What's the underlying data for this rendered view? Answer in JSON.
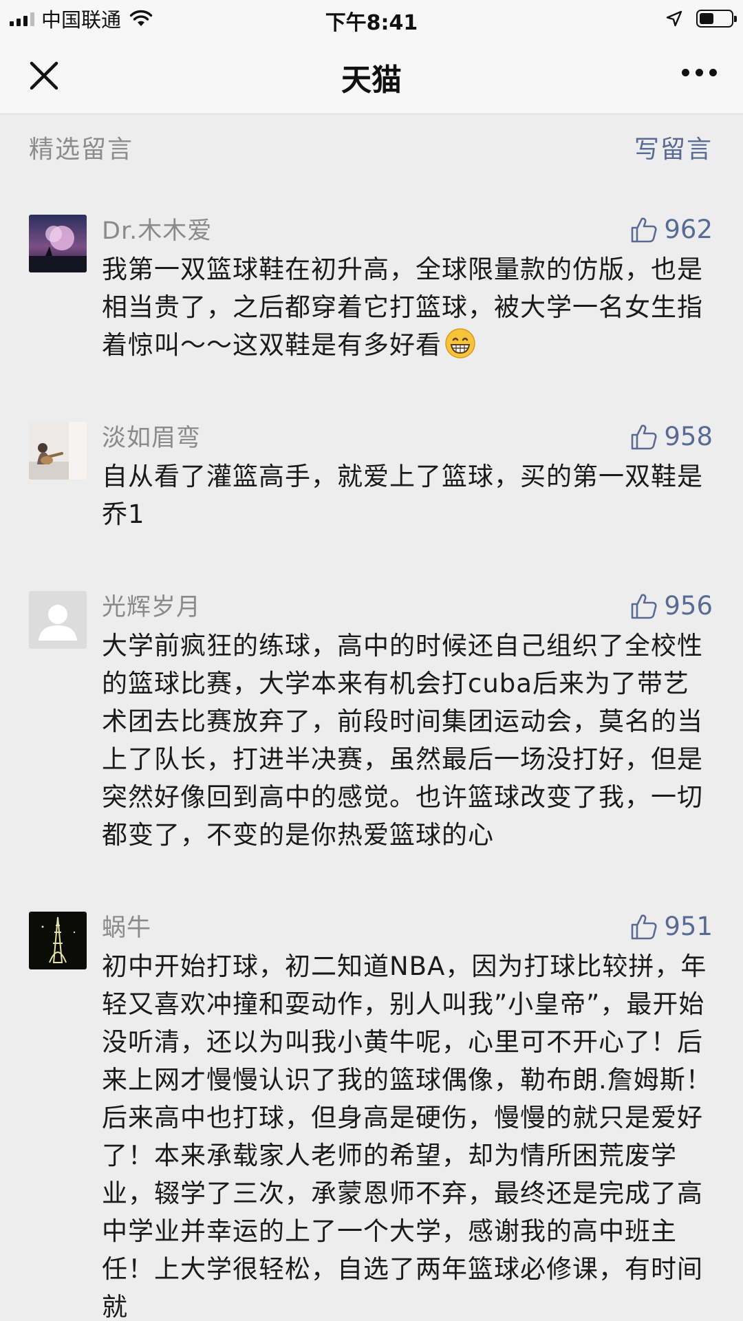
{
  "status_bar": {
    "carrier": "中国联通",
    "time": "下午8:41",
    "battery_level": 0.45
  },
  "nav": {
    "title": "天猫"
  },
  "section": {
    "title": "精选留言",
    "write_label": "写留言"
  },
  "comments": [
    {
      "name": "Dr.木木爱",
      "likes": "962",
      "text": "我第一双篮球鞋在初升高，全球限量款的仿版，也是相当贵了，之后都穿着它打篮球，被大学一名女生指着惊叫～～这双鞋是有多好看",
      "emoji": "grinning-face-icon"
    },
    {
      "name": "淡如眉弯",
      "likes": "958",
      "text": "自从看了灌篮高手，就爱上了篮球，买的第一双鞋是乔1"
    },
    {
      "name": "光辉岁月",
      "likes": "956",
      "text": "大学前疯狂的练球，高中的时候还自己组织了全校性的篮球比赛，大学本来有机会打cuba后来为了带艺术团去比赛放弃了，前段时间集团运动会，莫名的当上了队长，打进半决赛，虽然最后一场没打好，但是突然好像回到高中的感觉。也许篮球改变了我，一切都变了，不变的是你热爱篮球的心"
    },
    {
      "name": "蜗牛",
      "likes": "951",
      "text": "初中开始打球，初二知道NBA，因为打球比较拼，年轻又喜欢冲撞和耍动作，别人叫我”小皇帝”，最开始没听清，还以为叫我小黄牛呢，心里可不开心了！后来上网才慢慢认识了我的篮球偶像，勒布朗.詹姆斯！后来高中也打球，但身高是硬伤，慢慢的就只是爱好了！本来承载家人老师的希望，却为情所困荒废学业，辍学了三次，承蒙恩师不弃，最终还是完成了高中学业并幸运的上了一个大学，感谢我的高中班主任！上大学很轻松，自选了两年篮球必修课，有时间就"
    }
  ]
}
